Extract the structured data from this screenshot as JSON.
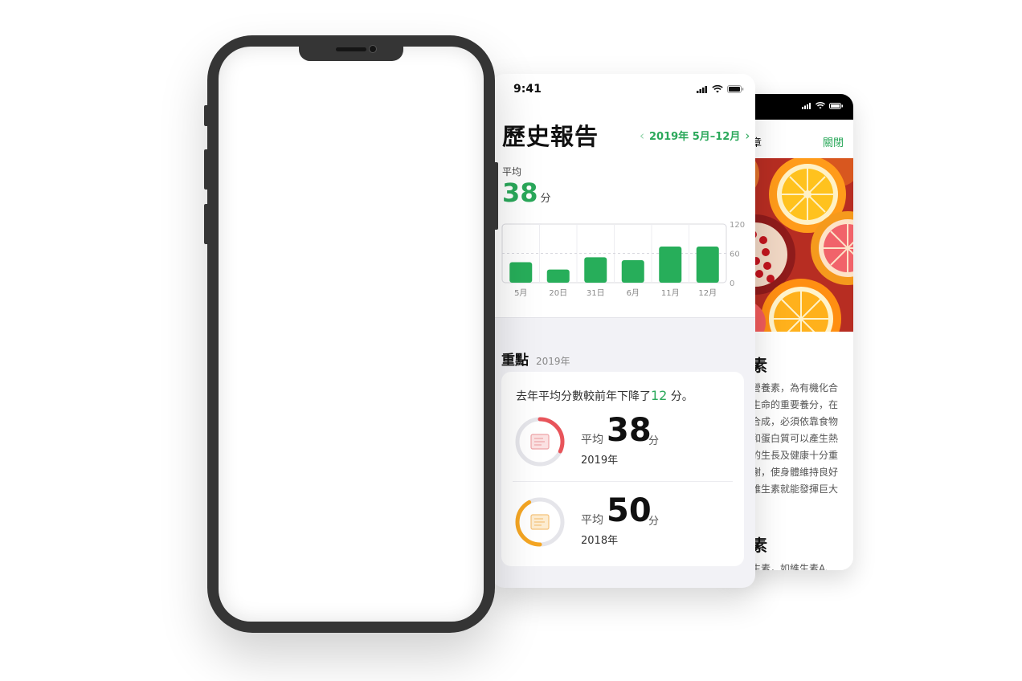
{
  "article_card": {
    "header_title": "章",
    "close_label": "關閉",
    "heading": "素",
    "body_lines": [
      "營養素，為有機化合",
      "生命的重要養分，在",
      "合成，必須依靠食物",
      "和蛋白質可以產生熱",
      "的生長及健康十分重",
      "謝，使身體維持良好",
      "維生素就能發揮巨大"
    ],
    "subheading": "素",
    "cut_line": "生素，如維生素A、"
  },
  "report_card": {
    "status_time": "9:41",
    "title": "歷史報告",
    "date_range": "2019年 5月–12月",
    "avg_label": "平均",
    "avg_value": "38",
    "avg_unit": "分",
    "highlights_title": "重點",
    "highlights_year": "2019年",
    "summary_prefix": "去年平均分數較前年下降了",
    "summary_value": "12",
    "summary_suffix": " 分。",
    "rows": [
      {
        "avg_label": "平均",
        "score": "38",
        "unit": "分",
        "year": "2019年",
        "color": "#e8545a",
        "fraction": 0.32
      },
      {
        "avg_label": "平均",
        "score": "50",
        "unit": "分",
        "year": "2018年",
        "color": "#f5a623",
        "fraction": 0.42
      }
    ]
  },
  "chart_data": {
    "type": "bar",
    "categories": [
      "5月",
      "20日",
      "31日",
      "6月",
      "11月",
      "12月"
    ],
    "values": [
      42,
      27,
      52,
      46,
      74,
      74
    ],
    "ylim": [
      0,
      120
    ],
    "yticks": [
      0,
      60,
      120
    ],
    "color": "#27ae5a",
    "grid": true
  }
}
